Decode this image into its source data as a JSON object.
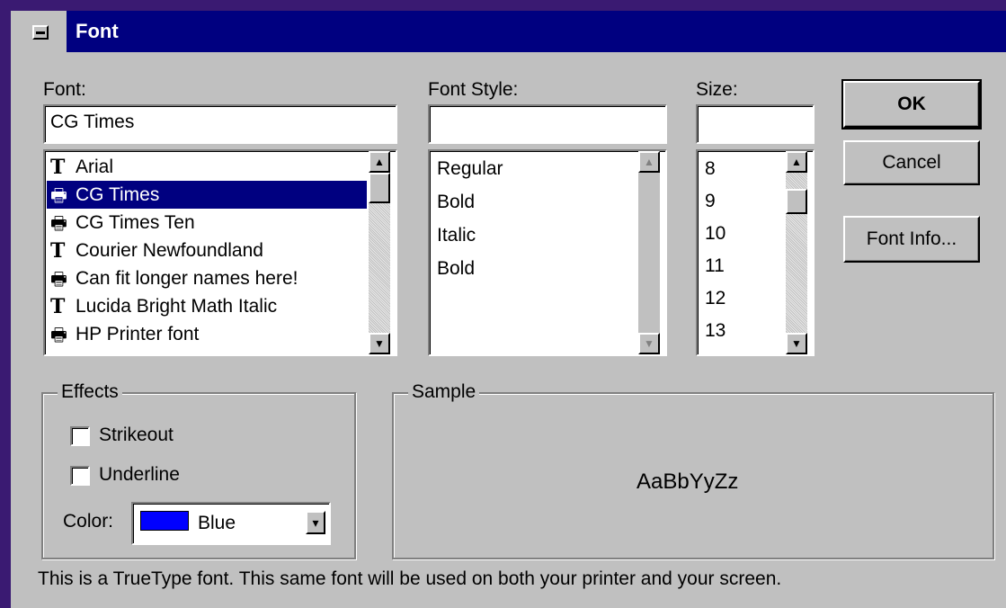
{
  "title": "Font",
  "font": {
    "label": "Font:",
    "value": "CG Times",
    "items": [
      {
        "icon": "truetype",
        "label": "Arial"
      },
      {
        "icon": "printer",
        "label": "CG Times"
      },
      {
        "icon": "printer",
        "label": "CG Times Ten"
      },
      {
        "icon": "truetype",
        "label": "Courier Newfoundland"
      },
      {
        "icon": "printer",
        "label": "Can fit longer names here!"
      },
      {
        "icon": "truetype",
        "label": "Lucida Bright Math Italic"
      },
      {
        "icon": "printer",
        "label": "HP Printer font"
      }
    ],
    "selected": "CG Times"
  },
  "style": {
    "label": "Font Style:",
    "value": "",
    "items": [
      "Regular",
      "Bold",
      "Italic",
      "Bold"
    ]
  },
  "size": {
    "label": "Size:",
    "value": "",
    "items": [
      "8",
      "9",
      "10",
      "11",
      "12",
      "13"
    ]
  },
  "buttons": {
    "ok": "OK",
    "cancel": "Cancel",
    "font_info": "Font Info..."
  },
  "effects": {
    "legend": "Effects",
    "strikeout": "Strikeout",
    "underline": "Underline",
    "color_label": "Color:",
    "color_value": "Blue",
    "color_hex": "#0000ff"
  },
  "sample": {
    "legend": "Sample",
    "text": "AaBbYyZz"
  },
  "status": "This is a TrueType font. This same font will be used on both your printer and your screen.",
  "colors": {
    "titlebar": "#000080",
    "dialog": "#c0c0c0",
    "desktop": "#3a1a72",
    "selection": "#000080"
  }
}
